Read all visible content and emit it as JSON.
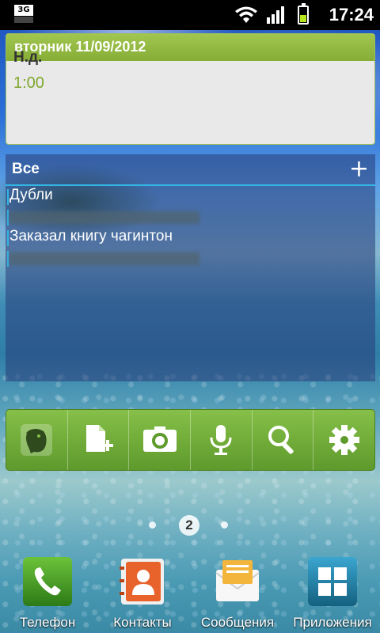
{
  "status_bar": {
    "network": "3G",
    "time": "17:24",
    "battery_level": 0.45
  },
  "calendar_widget": {
    "date_header": "вторник 11/09/2012",
    "event_title": "Н.д.",
    "event_time": "1:00"
  },
  "notes_widget": {
    "title": "Все",
    "add_label": "+",
    "items": [
      {
        "text": "Дубли",
        "redacted": false
      },
      {
        "text": "",
        "redacted": true
      },
      {
        "text": "Заказал книгу чагинтон",
        "redacted": false
      },
      {
        "text": "",
        "redacted": true
      }
    ]
  },
  "evernote_toolbar": {
    "buttons": [
      "evernote-elephant-icon",
      "new-note-icon",
      "camera-icon",
      "microphone-icon",
      "search-icon",
      "settings-gear-icon"
    ]
  },
  "pager": {
    "current_page": "2"
  },
  "dock": [
    {
      "label": "Телефон",
      "icon": "phone-icon",
      "color": "#3a8d1f"
    },
    {
      "label": "Контакты",
      "icon": "contacts-icon",
      "color": "#e8622b"
    },
    {
      "label": "Сообщения",
      "icon": "messages-icon",
      "color": "#f4b53c"
    },
    {
      "label": "Приложения",
      "icon": "apps-grid-icon",
      "color": "#1f7fa8"
    }
  ]
}
